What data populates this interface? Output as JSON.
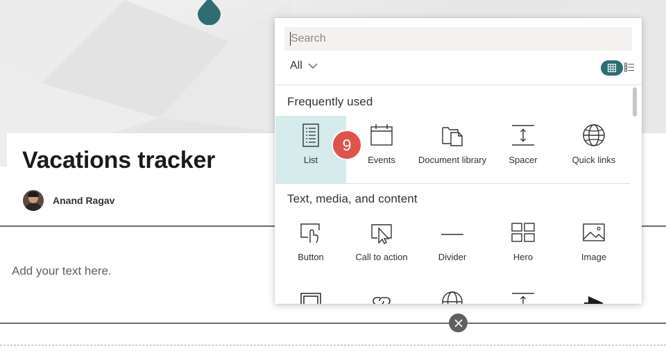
{
  "page": {
    "title": "Vacations tracker",
    "author": "Anand Ragav",
    "body_placeholder": "Add your text here."
  },
  "toolbox": {
    "search_placeholder": "Search",
    "filter_label": "All",
    "view_modes": [
      "grid-icon",
      "list-view-icon"
    ],
    "scrollbar_position": 0.0,
    "sections": [
      {
        "title": "Frequently used",
        "items": [
          {
            "label": "List",
            "icon": "list-icon",
            "selected": true
          },
          {
            "label": "Events",
            "icon": "calendar-icon"
          },
          {
            "label": "Document library",
            "icon": "document-library-icon"
          },
          {
            "label": "Spacer",
            "icon": "spacer-icon"
          },
          {
            "label": "Quick links",
            "icon": "globe-icon"
          }
        ]
      },
      {
        "title": "Text, media, and content",
        "items": [
          {
            "label": "Button",
            "icon": "button-click-icon"
          },
          {
            "label": "Call to action",
            "icon": "call-to-action-icon"
          },
          {
            "label": "Divider",
            "icon": "divider-icon"
          },
          {
            "label": "Hero",
            "icon": "hero-icon"
          },
          {
            "label": "Image",
            "icon": "image-icon"
          }
        ]
      },
      {
        "items": [
          {
            "icon": "image-gallery-icon"
          },
          {
            "icon": "link-icon"
          },
          {
            "icon": "globe-icon"
          },
          {
            "icon": "spacer-icon"
          },
          {
            "icon": "stream-play-icon"
          }
        ]
      }
    ]
  },
  "step_badge": "9",
  "colors": {
    "accent": "#2f6d73",
    "selected_tile": "#d5ebec",
    "badge": "#e0534a",
    "pin": "#2f6d73"
  }
}
